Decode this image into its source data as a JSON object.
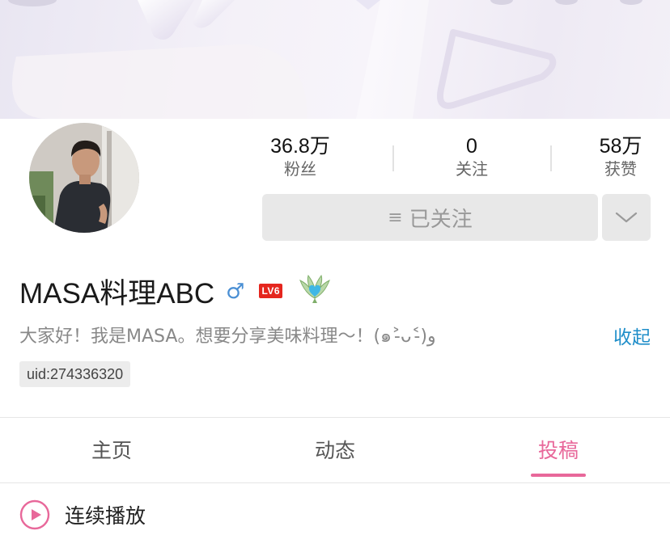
{
  "profile": {
    "avatar_icon": "user-avatar-photo",
    "name": "MASA料理ABC",
    "gender_symbol": "♂",
    "level": "LV6",
    "badge_icon": "winged-heart-badge-icon",
    "bio": "大家好！我是MASA。想要分享美味料理～！(๑˃̵ᴗ˂̵)و",
    "collapse_label": "收起",
    "uid": "uid:274336320"
  },
  "stats": [
    {
      "value": "36.8万",
      "label": "粉丝"
    },
    {
      "value": "0",
      "label": "关注"
    },
    {
      "value": "58万",
      "label": "获赞"
    }
  ],
  "actions": {
    "follow_icon": "≡",
    "follow_label": "已关注",
    "more_icon": "chevron-down-icon"
  },
  "tabs": [
    {
      "label": "主页",
      "active": false
    },
    {
      "label": "动态",
      "active": false
    },
    {
      "label": "投稿",
      "active": true
    }
  ],
  "autoplay": {
    "icon": "play-circle-icon",
    "label": "连续播放"
  },
  "colors": {
    "accent_pink": "#e8689a",
    "link_blue": "#1f8ec9",
    "gender_blue": "#4a8fd4",
    "level_red": "#e5261e"
  }
}
